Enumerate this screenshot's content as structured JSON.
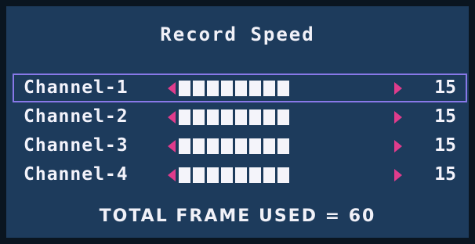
{
  "title": "Record Speed",
  "channels": [
    {
      "label": "Channel-1",
      "value": "15",
      "segments": 8,
      "selected": true
    },
    {
      "label": "Channel-2",
      "value": "15",
      "segments": 8,
      "selected": false
    },
    {
      "label": "Channel-3",
      "value": "15",
      "segments": 8,
      "selected": false
    },
    {
      "label": "Channel-4",
      "value": "15",
      "segments": 8,
      "selected": false
    }
  ],
  "total_text": "TOTAL FRAME USED = 60",
  "colors": {
    "background": "#1d3b5c",
    "text": "#f3f3fb",
    "arrow": "#e03c8c",
    "selection": "#8878e8"
  },
  "icons": {
    "left_arrow": "triangle-left-icon",
    "right_arrow": "triangle-right-icon"
  }
}
